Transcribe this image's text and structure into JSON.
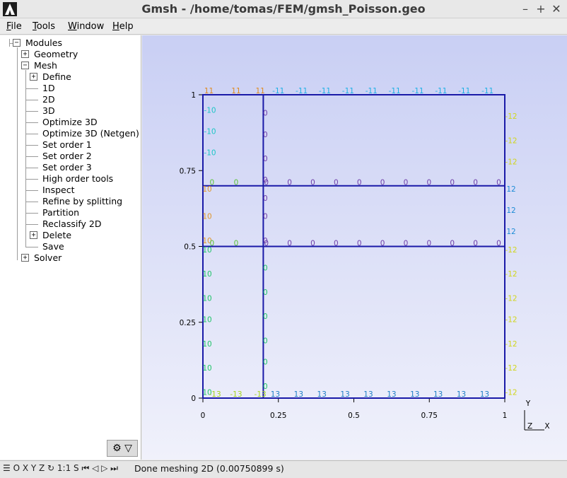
{
  "window": {
    "title": "Gmsh - /home/tomas/FEM/gmsh_Poisson.geo",
    "minimize": "–",
    "maximize": "+",
    "close": "✕"
  },
  "menu": [
    {
      "label": "File",
      "accel": "F",
      "rest": "ile"
    },
    {
      "label": "Tools",
      "accel": "T",
      "rest": "ools"
    },
    {
      "label": "Window",
      "accel": "W",
      "rest": "indow"
    },
    {
      "label": "Help",
      "accel": "H",
      "rest": "elp"
    }
  ],
  "tree": {
    "root": "Modules",
    "geometry": "Geometry",
    "mesh": "Mesh",
    "mesh_items": [
      "Define",
      "1D",
      "2D",
      "3D",
      "Optimize 3D",
      "Optimize 3D (Netgen)",
      "Set order 1",
      "Set order 2",
      "Set order 3",
      "High order tools",
      "Inspect",
      "Refine by splitting",
      "Partition",
      "Reclassify 2D",
      "Delete",
      "Save"
    ],
    "solver": "Solver",
    "expanded_icon": "−",
    "collapsed_icon": "+"
  },
  "gear_button": {
    "icon": "gear-icon",
    "glyph": "⚙ ▽"
  },
  "plot": {
    "x_ticks": [
      "0",
      "0.25",
      "0.5",
      "0.75",
      "1"
    ],
    "y_ticks": [
      "0",
      "0.25",
      "0.5",
      "0.75",
      "1"
    ],
    "axis_x": "X",
    "axis_y": "Y",
    "axis_z": "Z",
    "line_color": "#1a1aa8",
    "labels": {
      "top": {
        "left": "11",
        "right": "-11"
      },
      "left": {
        "upper": "-10",
        "mid": "10",
        "lower": "10"
      },
      "right": {
        "upper": "-12",
        "mid": "12",
        "lower": "-12"
      },
      "bottom": {
        "left": "-13",
        "right": "13"
      },
      "interior": "0"
    },
    "colors": {
      "c10": "#21c46a",
      "cneg10": "#1ec6c6",
      "c11": "#e08a1e",
      "cneg11": "#1eb0e6",
      "cneg12": "#d0d61e",
      "c12": "#1e8cd6",
      "cneg13": "#a4d41e",
      "c13": "#1e7fc6",
      "c0": "#6e3ea8",
      "c0b": "#5cc23a",
      "c10o": "#e0962a"
    }
  },
  "status": {
    "tools": "☰ O X Y Z ↻ 1:1 S ⏮ ◁ ▷ ⏭",
    "message": "Done meshing 2D (0.00750899 s)"
  }
}
